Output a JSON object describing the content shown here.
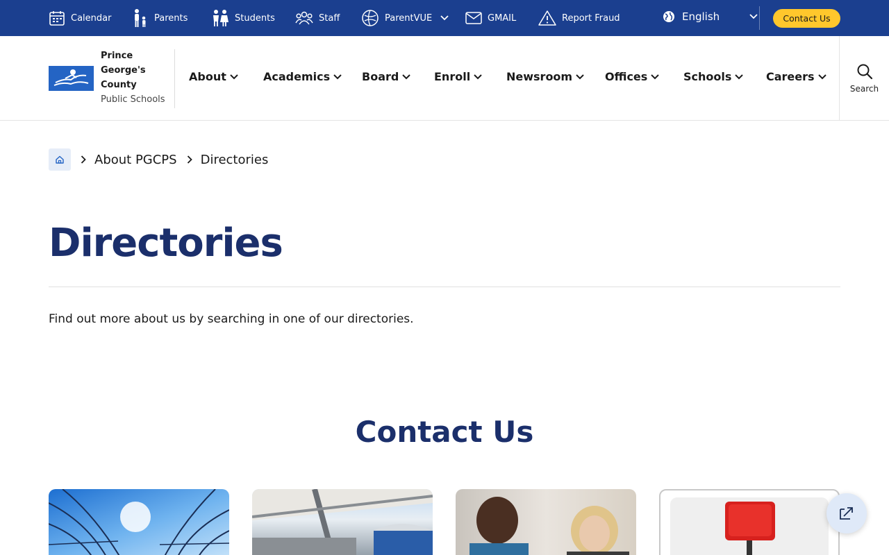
{
  "topbar": {
    "items": [
      {
        "label": "Calendar",
        "icon": "calendar-icon"
      },
      {
        "label": "Parents",
        "icon": "parent-child-icon"
      },
      {
        "label": "Students",
        "icon": "students-icon"
      },
      {
        "label": "Staff",
        "icon": "staff-group-icon"
      },
      {
        "label": "ParentVUE",
        "icon": "parentvue-icon"
      },
      {
        "label": "GMAIL",
        "icon": "mail-icon"
      },
      {
        "label": "Report Fraud",
        "icon": "warning-icon"
      }
    ],
    "language": "English",
    "contact_label": "Contact Us"
  },
  "logo": {
    "line1": "Prince",
    "line2": "George's",
    "line3": "County",
    "line4": "Public Schools"
  },
  "nav": {
    "items": [
      "About",
      "Academics",
      "Board",
      "Enroll",
      "Newsroom",
      "Offices",
      "Schools",
      "Careers"
    ],
    "search_label": "Search"
  },
  "breadcrumb": {
    "items": [
      "About PGCPS",
      "Directories"
    ]
  },
  "page": {
    "title": "Directories",
    "intro": "Find out more about us by searching in one of our directories.",
    "section_title": "Contact Us"
  },
  "colors": {
    "topbar": "#1b3f8f",
    "accent": "#ffc72c",
    "heading": "#1b2f6b",
    "logo": "#2464c4"
  }
}
